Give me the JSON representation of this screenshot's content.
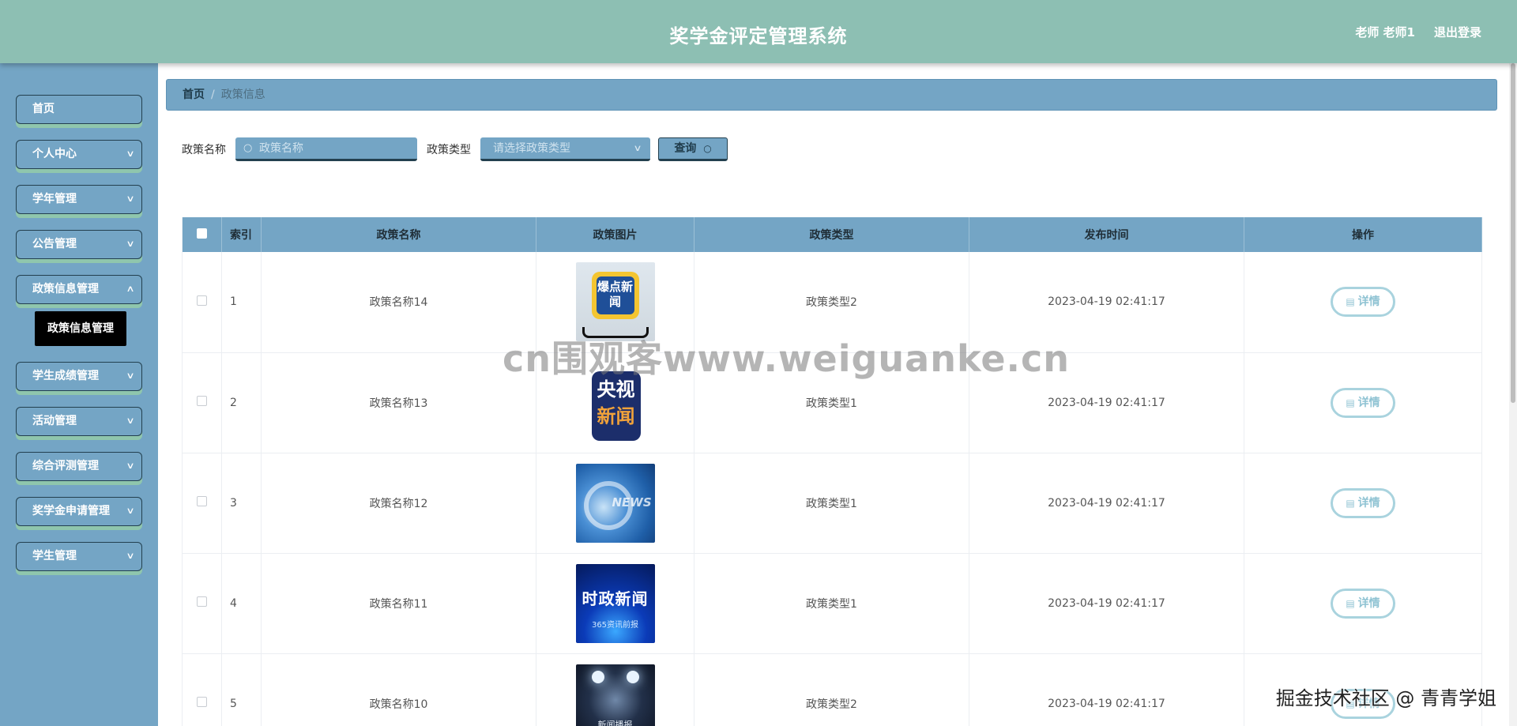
{
  "header": {
    "title": "奖学金评定管理系统",
    "user": "老师 老师1",
    "logout": "退出登录"
  },
  "sidebar": {
    "items": [
      {
        "label": "首页",
        "has_children": false
      },
      {
        "label": "个人中心",
        "has_children": true
      },
      {
        "label": "学年管理",
        "has_children": true
      },
      {
        "label": "公告管理",
        "has_children": true
      },
      {
        "label": "政策信息管理",
        "has_children": true,
        "expanded": true
      },
      {
        "label": "学生成绩管理",
        "has_children": true
      },
      {
        "label": "活动管理",
        "has_children": true
      },
      {
        "label": "综合评测管理",
        "has_children": true
      },
      {
        "label": "奖学金申请管理",
        "has_children": true
      },
      {
        "label": "学生管理",
        "has_children": true
      }
    ],
    "sub_item": {
      "label": "政策信息管理"
    }
  },
  "breadcrumb": {
    "home": "首页",
    "separator": "/",
    "current": "政策信息"
  },
  "search": {
    "name_label": "政策名称",
    "name_placeholder": "政策名称",
    "type_label": "政策类型",
    "type_placeholder": "请选择政策类型",
    "query_label": "查询"
  },
  "table": {
    "headers": [
      "索引",
      "政策名称",
      "政策图片",
      "政策类型",
      "发布时间",
      "操作"
    ],
    "rows": [
      {
        "index": "1",
        "name": "政策名称14",
        "image": "爆点新闻",
        "type": "政策类型2",
        "time": "2023-04-19 02:41:17",
        "action": "详情"
      },
      {
        "index": "2",
        "name": "政策名称13",
        "image": "央视新闻",
        "type": "政策类型1",
        "time": "2023-04-19 02:41:17",
        "action": "详情"
      },
      {
        "index": "3",
        "name": "政策名称12",
        "image": "NEWS",
        "type": "政策类型1",
        "time": "2023-04-19 02:41:17",
        "action": "详情"
      },
      {
        "index": "4",
        "name": "政策名称11",
        "image": "时政新闻",
        "type": "政策类型1",
        "time": "2023-04-19 02:41:17",
        "action": "详情"
      },
      {
        "index": "5",
        "name": "政策名称10",
        "image": "新闻播报",
        "type": "政策类型2",
        "time": "2023-04-19 02:41:17",
        "action": "详情"
      }
    ]
  },
  "image_texts": {
    "img1": "爆点新闻",
    "img2_a": "央视",
    "img2_b": "新闻",
    "img3": "NEWS",
    "img4_a": "时政新闻",
    "img4_b": "365资讯前报",
    "img5": "新闻播报"
  },
  "watermarks": {
    "center": "cn围观客www.weiguanke.cn",
    "corner": "掘金技术社区 @ 青青学姐"
  },
  "colors": {
    "header_bg": "#8dbfb3",
    "sidebar_bg": "#74a5c5",
    "accent_dark": "#23404f",
    "nav_shadow": "#8fc6ad",
    "detail_border": "#a9d3de"
  }
}
